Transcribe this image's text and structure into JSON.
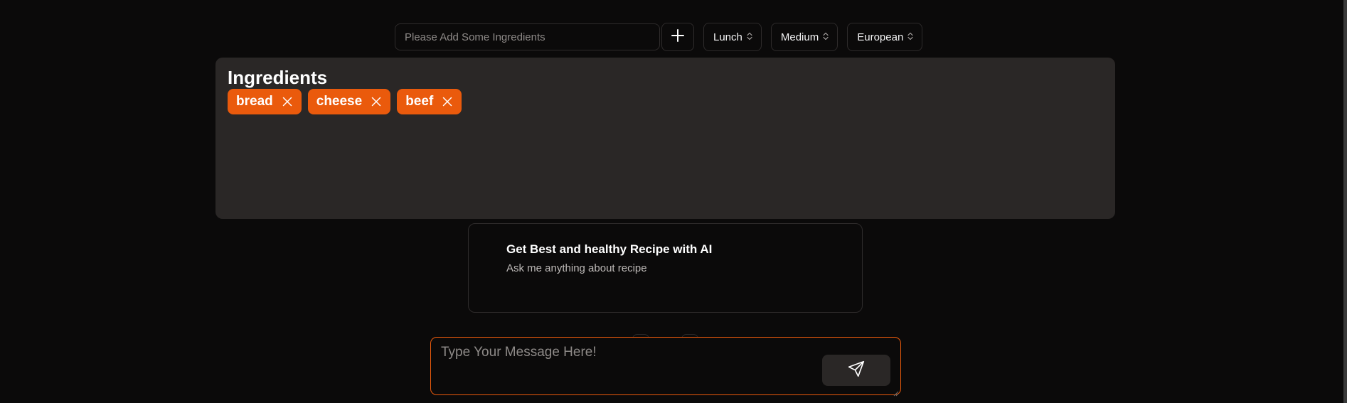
{
  "toolbar": {
    "ingredient_placeholder": "Please Add Some Ingredients",
    "add_icon": "plus-icon",
    "meal_type": "Lunch",
    "difficulty": "Medium",
    "cuisine": "European",
    "select_icon": "chevron-up-down-icon"
  },
  "ingredients": {
    "title": "Ingredients",
    "items": [
      "bread",
      "cheese",
      "beef"
    ],
    "remove_icon": "close-icon"
  },
  "suggestion": {
    "title": "Get Best and healthy Recipe with AI",
    "subtitle": "Ask me anything about recipe"
  },
  "composer": {
    "placeholder": "Type Your Message Here!",
    "send_icon": "send-icon"
  },
  "colors": {
    "background": "#0b0a0a",
    "panel": "#2a2726",
    "accent": "#ea5a0c",
    "border": "#2e2b2b"
  }
}
